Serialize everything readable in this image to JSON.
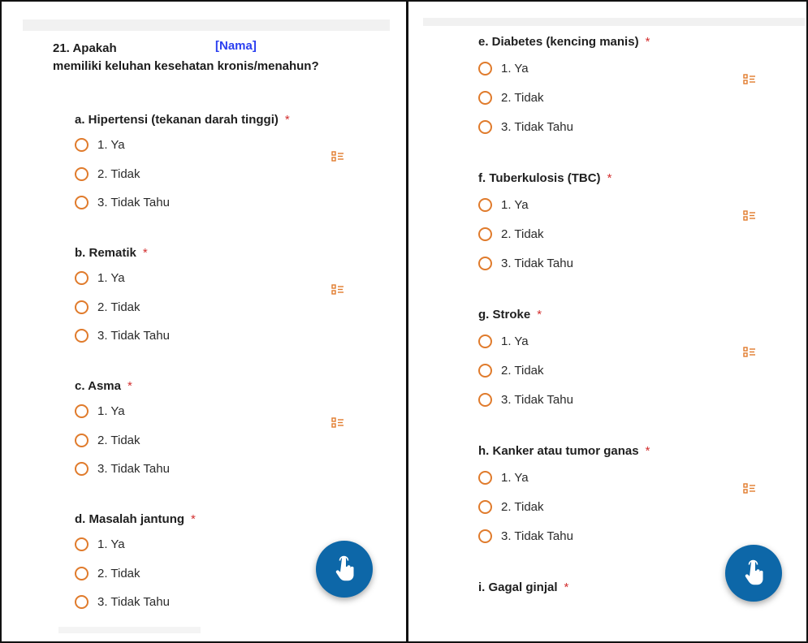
{
  "colors": {
    "radio_border": "#e07b2c",
    "required_star": "#d32f2f",
    "placeholder_name": "#2b3ff0",
    "fab_background": "#0d67a8",
    "list_icon": "#e07b2c"
  },
  "question": {
    "number_text": "21. Apakah",
    "placeholder": "[Nama]",
    "line2": "memiliki keluhan kesehatan kronis/menahun?"
  },
  "required_mark": "*",
  "options": [
    "1. Ya",
    "2. Tidak",
    "3. Tidak Tahu"
  ],
  "sections": [
    {
      "title": "a. Hipertensi (tekanan darah tinggi)",
      "required": "*",
      "options": [
        "1. Ya",
        "2. Tidak",
        "3. Tidak Tahu"
      ]
    },
    {
      "title": "b. Rematik",
      "required": "*",
      "options": [
        "1. Ya",
        "2. Tidak",
        "3. Tidak Tahu"
      ]
    },
    {
      "title": "c. Asma",
      "required": "*",
      "options": [
        "1. Ya",
        "2. Tidak",
        "3. Tidak Tahu"
      ]
    },
    {
      "title": "d. Masalah jantung",
      "required": "*",
      "options": [
        "1. Ya",
        "2. Tidak",
        "3. Tidak Tahu"
      ]
    },
    {
      "title": "e. Diabetes (kencing manis)",
      "required": "*",
      "options": [
        "1. Ya",
        "2. Tidak",
        "3. Tidak Tahu"
      ]
    },
    {
      "title": "f. Tuberkulosis (TBC)",
      "required": "*",
      "options": [
        "1. Ya",
        "2. Tidak",
        "3. Tidak Tahu"
      ]
    },
    {
      "title": "g. Stroke",
      "required": "*",
      "options": [
        "1. Ya",
        "2. Tidak",
        "3. Tidak Tahu"
      ]
    },
    {
      "title": "h. Kanker atau tumor ganas",
      "required": "*",
      "options": [
        "1. Ya",
        "2. Tidak",
        "3. Tidak Tahu"
      ]
    },
    {
      "title": "i. Gagal ginjal",
      "required": "*"
    }
  ],
  "icons": {
    "list_icon": "list-choice-icon",
    "fab_icon": "touch-hand-icon"
  }
}
